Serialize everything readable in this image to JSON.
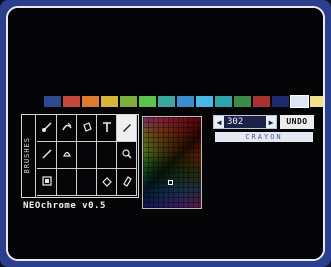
{
  "palette": {
    "colors": [
      "#2f4a8c",
      "#c4493c",
      "#e07a2c",
      "#d9b43a",
      "#7cae3a",
      "#5cc24a",
      "#3aa8a0",
      "#3a8fd0",
      "#4ab8e6",
      "#2ea3a8",
      "#3c8a4a",
      "#a8322e",
      "#1c2a6e",
      "#dfe6f3",
      "#f5e08a",
      "#c8d4ea"
    ],
    "selected_index": 13
  },
  "toolbox": {
    "side_label": "BRUSHES",
    "tools": [
      {
        "name": "brush-size-icon",
        "active": false
      },
      {
        "name": "smear-icon",
        "active": false
      },
      {
        "name": "bucket-icon",
        "active": false
      },
      {
        "name": "text-icon",
        "active": false
      },
      {
        "name": "pen-icon",
        "active": true
      },
      {
        "name": "line-icon",
        "active": false
      },
      {
        "name": "fill-icon",
        "active": false
      },
      {
        "name": "blank-tool",
        "active": false
      },
      {
        "name": "blank-tool",
        "active": false
      },
      {
        "name": "magnifier-icon",
        "active": false
      },
      {
        "name": "stamp-icon",
        "active": false
      },
      {
        "name": "blank-tool",
        "active": false
      },
      {
        "name": "blank-tool",
        "active": false
      },
      {
        "name": "eraser-icon",
        "active": false
      },
      {
        "name": "rubber-icon",
        "active": false
      }
    ]
  },
  "app": {
    "title": "NEOchrome v0.5"
  },
  "color_control": {
    "value": "302",
    "prev_symbol": "◀",
    "next_symbol": "▶",
    "undo_label": "UNDO",
    "mode_label": "CRAYON"
  }
}
